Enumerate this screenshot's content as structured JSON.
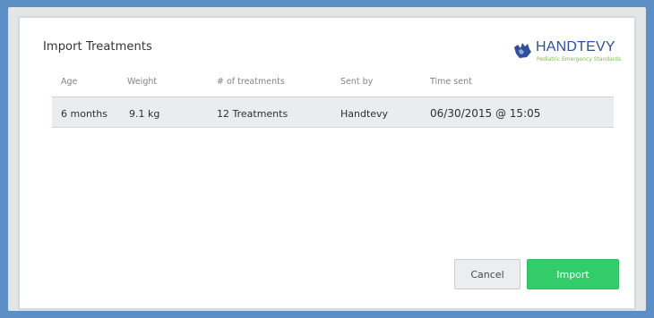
{
  "dialog": {
    "title": "Import Treatments"
  },
  "logo": {
    "name": "HANDTEVY",
    "tagline": "Pediatric Emergency Standards"
  },
  "table": {
    "columns": [
      "Age",
      "Weight",
      "# of treatments",
      "Sent by",
      "Time sent"
    ],
    "rows": [
      [
        "6 months",
        "9.1 kg",
        "12 Treatments",
        "Handtevy",
        "06/30/2015 @ 15:05"
      ]
    ]
  },
  "buttons": {
    "cancel": "Cancel",
    "import": "Import"
  },
  "colors": {
    "frame": "#5b8fc6",
    "import_button": "#33cc6b",
    "logo_blue": "#2d4f9e",
    "logo_green": "#7ebf3d"
  }
}
